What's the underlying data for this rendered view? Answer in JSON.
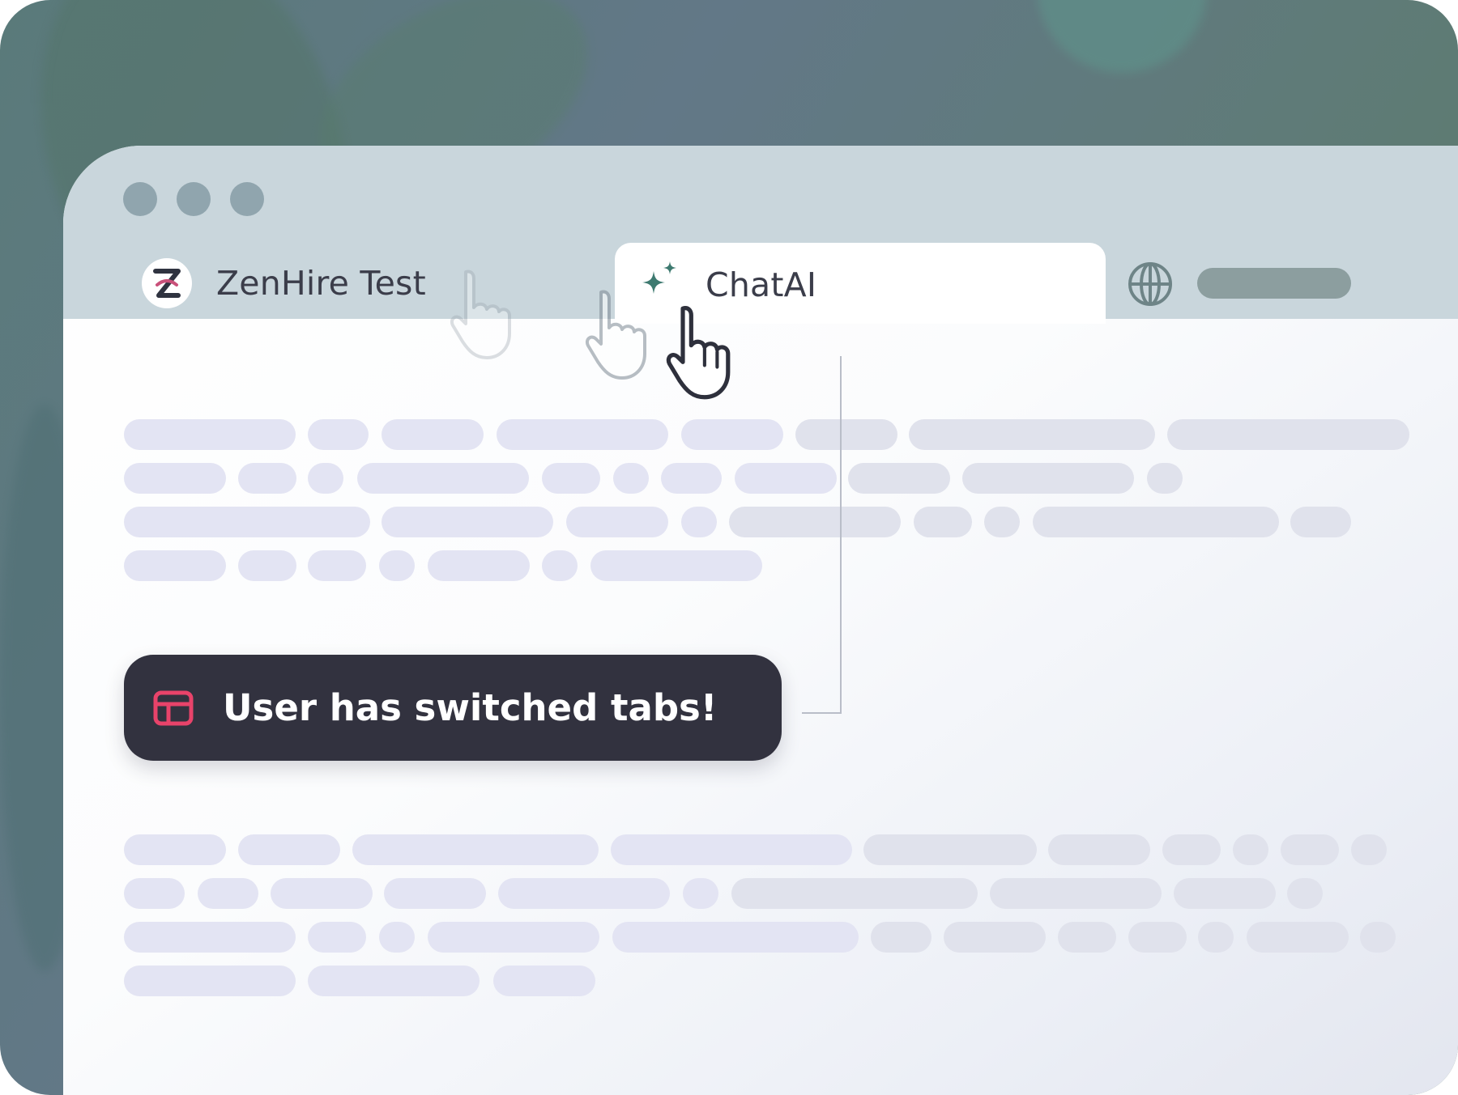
{
  "browser": {
    "window_controls": [
      "close",
      "minimize",
      "maximize"
    ],
    "tabs": [
      {
        "label": "ZenHire Test",
        "icon": "zenhire-logo-icon",
        "active": false
      },
      {
        "label": "ChatAI",
        "icon": "sparkle-icon",
        "active": true
      }
    ],
    "address_icon": "globe-icon"
  },
  "notification": {
    "icon": "layout-icon",
    "text": "User has switched tabs!"
  },
  "colors": {
    "toast_background": "#32323f",
    "toast_icon": "#e8436a",
    "sparkle": "#3e7a70",
    "tab_bar": "#c9d6dc"
  }
}
